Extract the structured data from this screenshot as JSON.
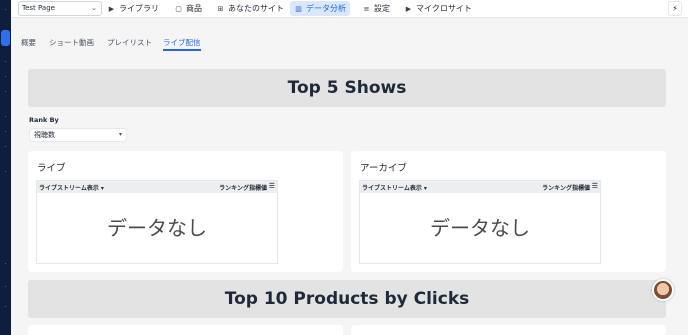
{
  "header": {
    "site_select": "Test Page",
    "nav": [
      {
        "label": "ライブラリ",
        "icon": "play-icon"
      },
      {
        "label": "商品",
        "icon": "bag-icon"
      },
      {
        "label": "あなたのサイト",
        "icon": "layout-icon"
      },
      {
        "label": "データ分析",
        "icon": "chart-icon",
        "active": true
      },
      {
        "label": "設定",
        "icon": "sliders-icon"
      },
      {
        "label": "マイクロサイト",
        "icon": "play-icon"
      }
    ]
  },
  "tabs": [
    {
      "label": "概要"
    },
    {
      "label": "ショート動画"
    },
    {
      "label": "プレイリスト"
    },
    {
      "label": "ライブ配信",
      "active": true
    }
  ],
  "sections": {
    "top_shows": "Top 5 Shows",
    "top_products": "Top 10 Products by Clicks"
  },
  "rank_by": {
    "label": "Rank By",
    "value": "視聴数"
  },
  "cards": [
    {
      "title": "ライブ",
      "column_left": "ライブストリーム表示",
      "column_right": "ランキング指標値",
      "empty": "データなし"
    },
    {
      "title": "アーカイブ",
      "column_left": "ライブストリーム表示",
      "column_right": "ランキング指標値",
      "empty": "データなし"
    }
  ],
  "colors": {
    "accent": "#2563eb",
    "rail": "#0f1e3d"
  }
}
